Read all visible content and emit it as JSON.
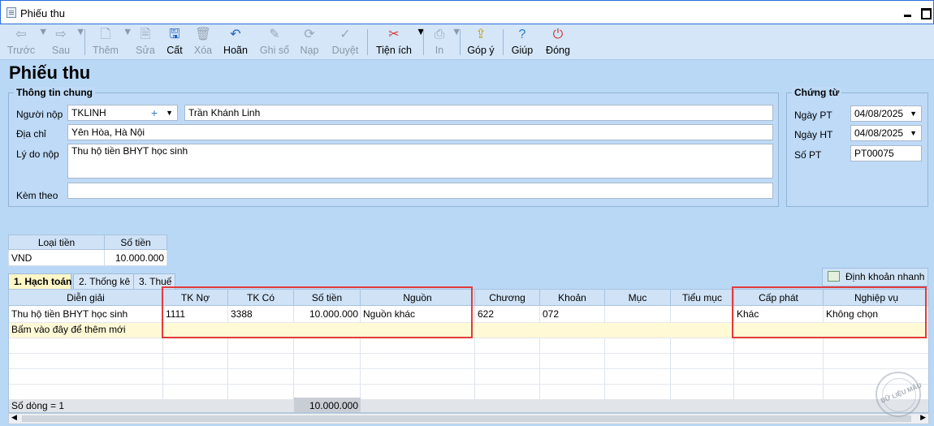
{
  "window": {
    "title": "Phiếu thu"
  },
  "toolbar": {
    "prev": "Trước",
    "next": "Sau",
    "add": "Thêm",
    "edit": "Sửa",
    "save": "Cất",
    "delete": "Xóa",
    "undo": "Hoãn",
    "post": "Ghi sổ",
    "reload": "Nạp",
    "approve": "Duyệt",
    "utilities": "Tiện ích",
    "print": "In",
    "feedback": "Góp ý",
    "help": "Giúp",
    "close": "Đóng"
  },
  "page_title": "Phiếu thu",
  "general": {
    "title": "Thông tin chung",
    "payer_label": "Người nộp",
    "payer_code": "TKLINH",
    "payer_name": "Trần Khánh Linh",
    "address_label": "Địa chỉ",
    "address": "Yên Hòa, Hà Nội",
    "reason_label": "Lý do nộp",
    "reason": "Thu hộ tiền BHYT học sinh",
    "attach_label": "Kèm theo",
    "attach": ""
  },
  "voucher": {
    "title": "Chứng từ",
    "date_pt_label": "Ngày PT",
    "date_pt": "04/08/2025",
    "date_ht_label": "Ngày HT",
    "date_ht": "04/08/2025",
    "so_pt_label": "Số PT",
    "so_pt": "PT00075"
  },
  "currency": {
    "headers": [
      "Loại tiền",
      "Số tiền"
    ],
    "type": "VND",
    "amount": "10.000.000"
  },
  "quick_entry": "Định khoản nhanh",
  "tabs": [
    "1. Hạch toán",
    "2. Thống kê",
    "3. Thuế"
  ],
  "grid": {
    "headers": [
      "Diễn giải",
      "TK Nợ",
      "TK Có",
      "Số tiền",
      "Nguồn",
      "Chương",
      "Khoản",
      "Mục",
      "Tiểu mục",
      "Cấp phát",
      "Nghiệp vụ"
    ],
    "row": {
      "desc": "Thu hộ tiền BHYT học sinh",
      "tk_no": "1111",
      "tk_co": "3388",
      "amount": "10.000.000",
      "source": "Nguồn khác",
      "chapter": "622",
      "section": "072",
      "item": "",
      "subitem": "",
      "allocation": "Khác",
      "operation": "Không chọn"
    },
    "add_row_hint": "Bấm vào đây để thêm mới",
    "footer_count": "Số dòng = 1",
    "footer_total": "10.000.000"
  },
  "watermark": "DỮ LIỆU MẪU"
}
